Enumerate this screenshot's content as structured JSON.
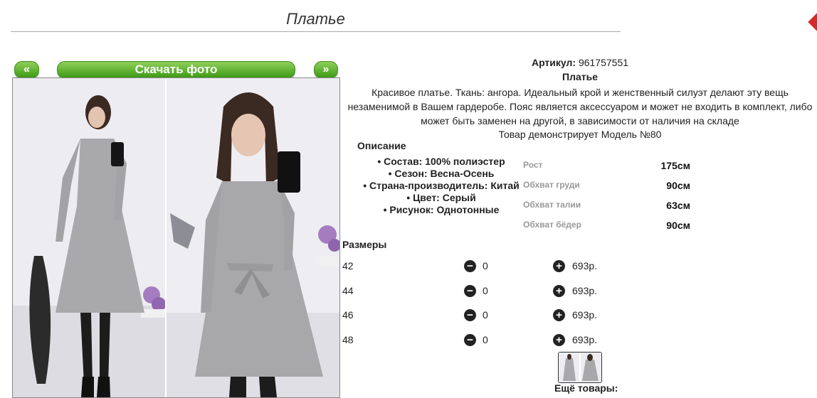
{
  "header": {
    "title": "Платье"
  },
  "gallery": {
    "prev_label": "«",
    "download_label": "Скачать фото",
    "next_label": "»"
  },
  "product": {
    "article_label": "Артикул:",
    "article_value": "961757551",
    "name": "Платье",
    "description_line1": "Красивое платье. Ткань: ангора. Идеальный крой и женственный силуэт делают эту вещь",
    "description_line2": "незаменимой в Вашем гардеробе. Пояс является аксессуаром и может не входить в комплект, либо",
    "description_line3": "может быть заменен на другой, в зависимости от наличия на складе",
    "model_text": "Товар демонстрирует Модель №80"
  },
  "description": {
    "heading": "Описание",
    "features": [
      "Состав: 100% полиэстер",
      "Сезон: Весна-Осень",
      "Страна-производитель: Китай",
      "Цвет: Серый",
      "Рисунок: Однотонные"
    ]
  },
  "measurements": [
    {
      "label": "Рост",
      "value": "175см"
    },
    {
      "label": "Обхват груди",
      "value": "90см"
    },
    {
      "label": "Обхват талии",
      "value": "63см"
    },
    {
      "label": "Обхват бёдер",
      "value": "90см"
    }
  ],
  "sizes": {
    "heading": "Размеры",
    "rows": [
      {
        "size": "42",
        "qty": "0",
        "price": "693р."
      },
      {
        "size": "44",
        "qty": "0",
        "price": "693р."
      },
      {
        "size": "46",
        "qty": "0",
        "price": "693р."
      },
      {
        "size": "48",
        "qty": "0",
        "price": "693р."
      }
    ]
  },
  "more_products": {
    "label": "Ещё товары:"
  },
  "icons": {
    "minus": "minus-circle-icon",
    "plus": "plus-circle-icon"
  },
  "colors": {
    "button_green": "#4aa81e",
    "accent_red": "#d42a2a"
  }
}
